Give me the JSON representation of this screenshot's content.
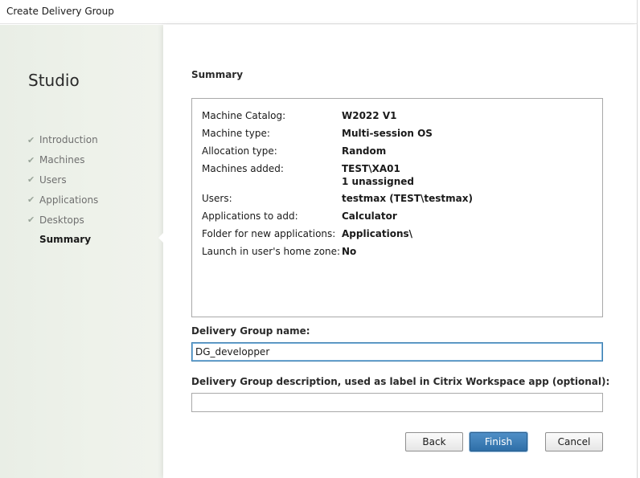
{
  "window": {
    "title": "Create Delivery Group"
  },
  "sidebar": {
    "brand": "Studio",
    "steps": [
      {
        "label": "Introduction",
        "completed": true
      },
      {
        "label": "Machines",
        "completed": true
      },
      {
        "label": "Users",
        "completed": true
      },
      {
        "label": "Applications",
        "completed": true
      },
      {
        "label": "Desktops",
        "completed": true
      },
      {
        "label": "Summary",
        "completed": false,
        "current": true
      }
    ],
    "check_glyph": "✔"
  },
  "main": {
    "heading": "Summary",
    "summary": [
      {
        "key": "Machine Catalog:",
        "value": "W2022 V1"
      },
      {
        "key": "Machine type:",
        "value": "Multi-session OS"
      },
      {
        "key": "Allocation type:",
        "value": "Random"
      },
      {
        "key": "Machines added:",
        "value": "TEST\\XA01",
        "value2": "1 unassigned"
      },
      {
        "key": "Users:",
        "value": "testmax (TEST\\testmax)"
      },
      {
        "key": "Applications to add:",
        "value": "Calculator"
      },
      {
        "key": "Folder for new applications:",
        "value": "Applications\\"
      },
      {
        "key": "Launch in user's home zone:",
        "value": "No"
      }
    ],
    "name_label": "Delivery Group name:",
    "name_value": "DG_developper",
    "description_label": "Delivery Group description, used as label in Citrix Workspace app (optional):",
    "description_value": ""
  },
  "buttons": {
    "back": "Back",
    "finish": "Finish",
    "cancel": "Cancel"
  },
  "colors": {
    "accent": "#2f6fa8",
    "sidebar_bg": "#eef2ea"
  }
}
